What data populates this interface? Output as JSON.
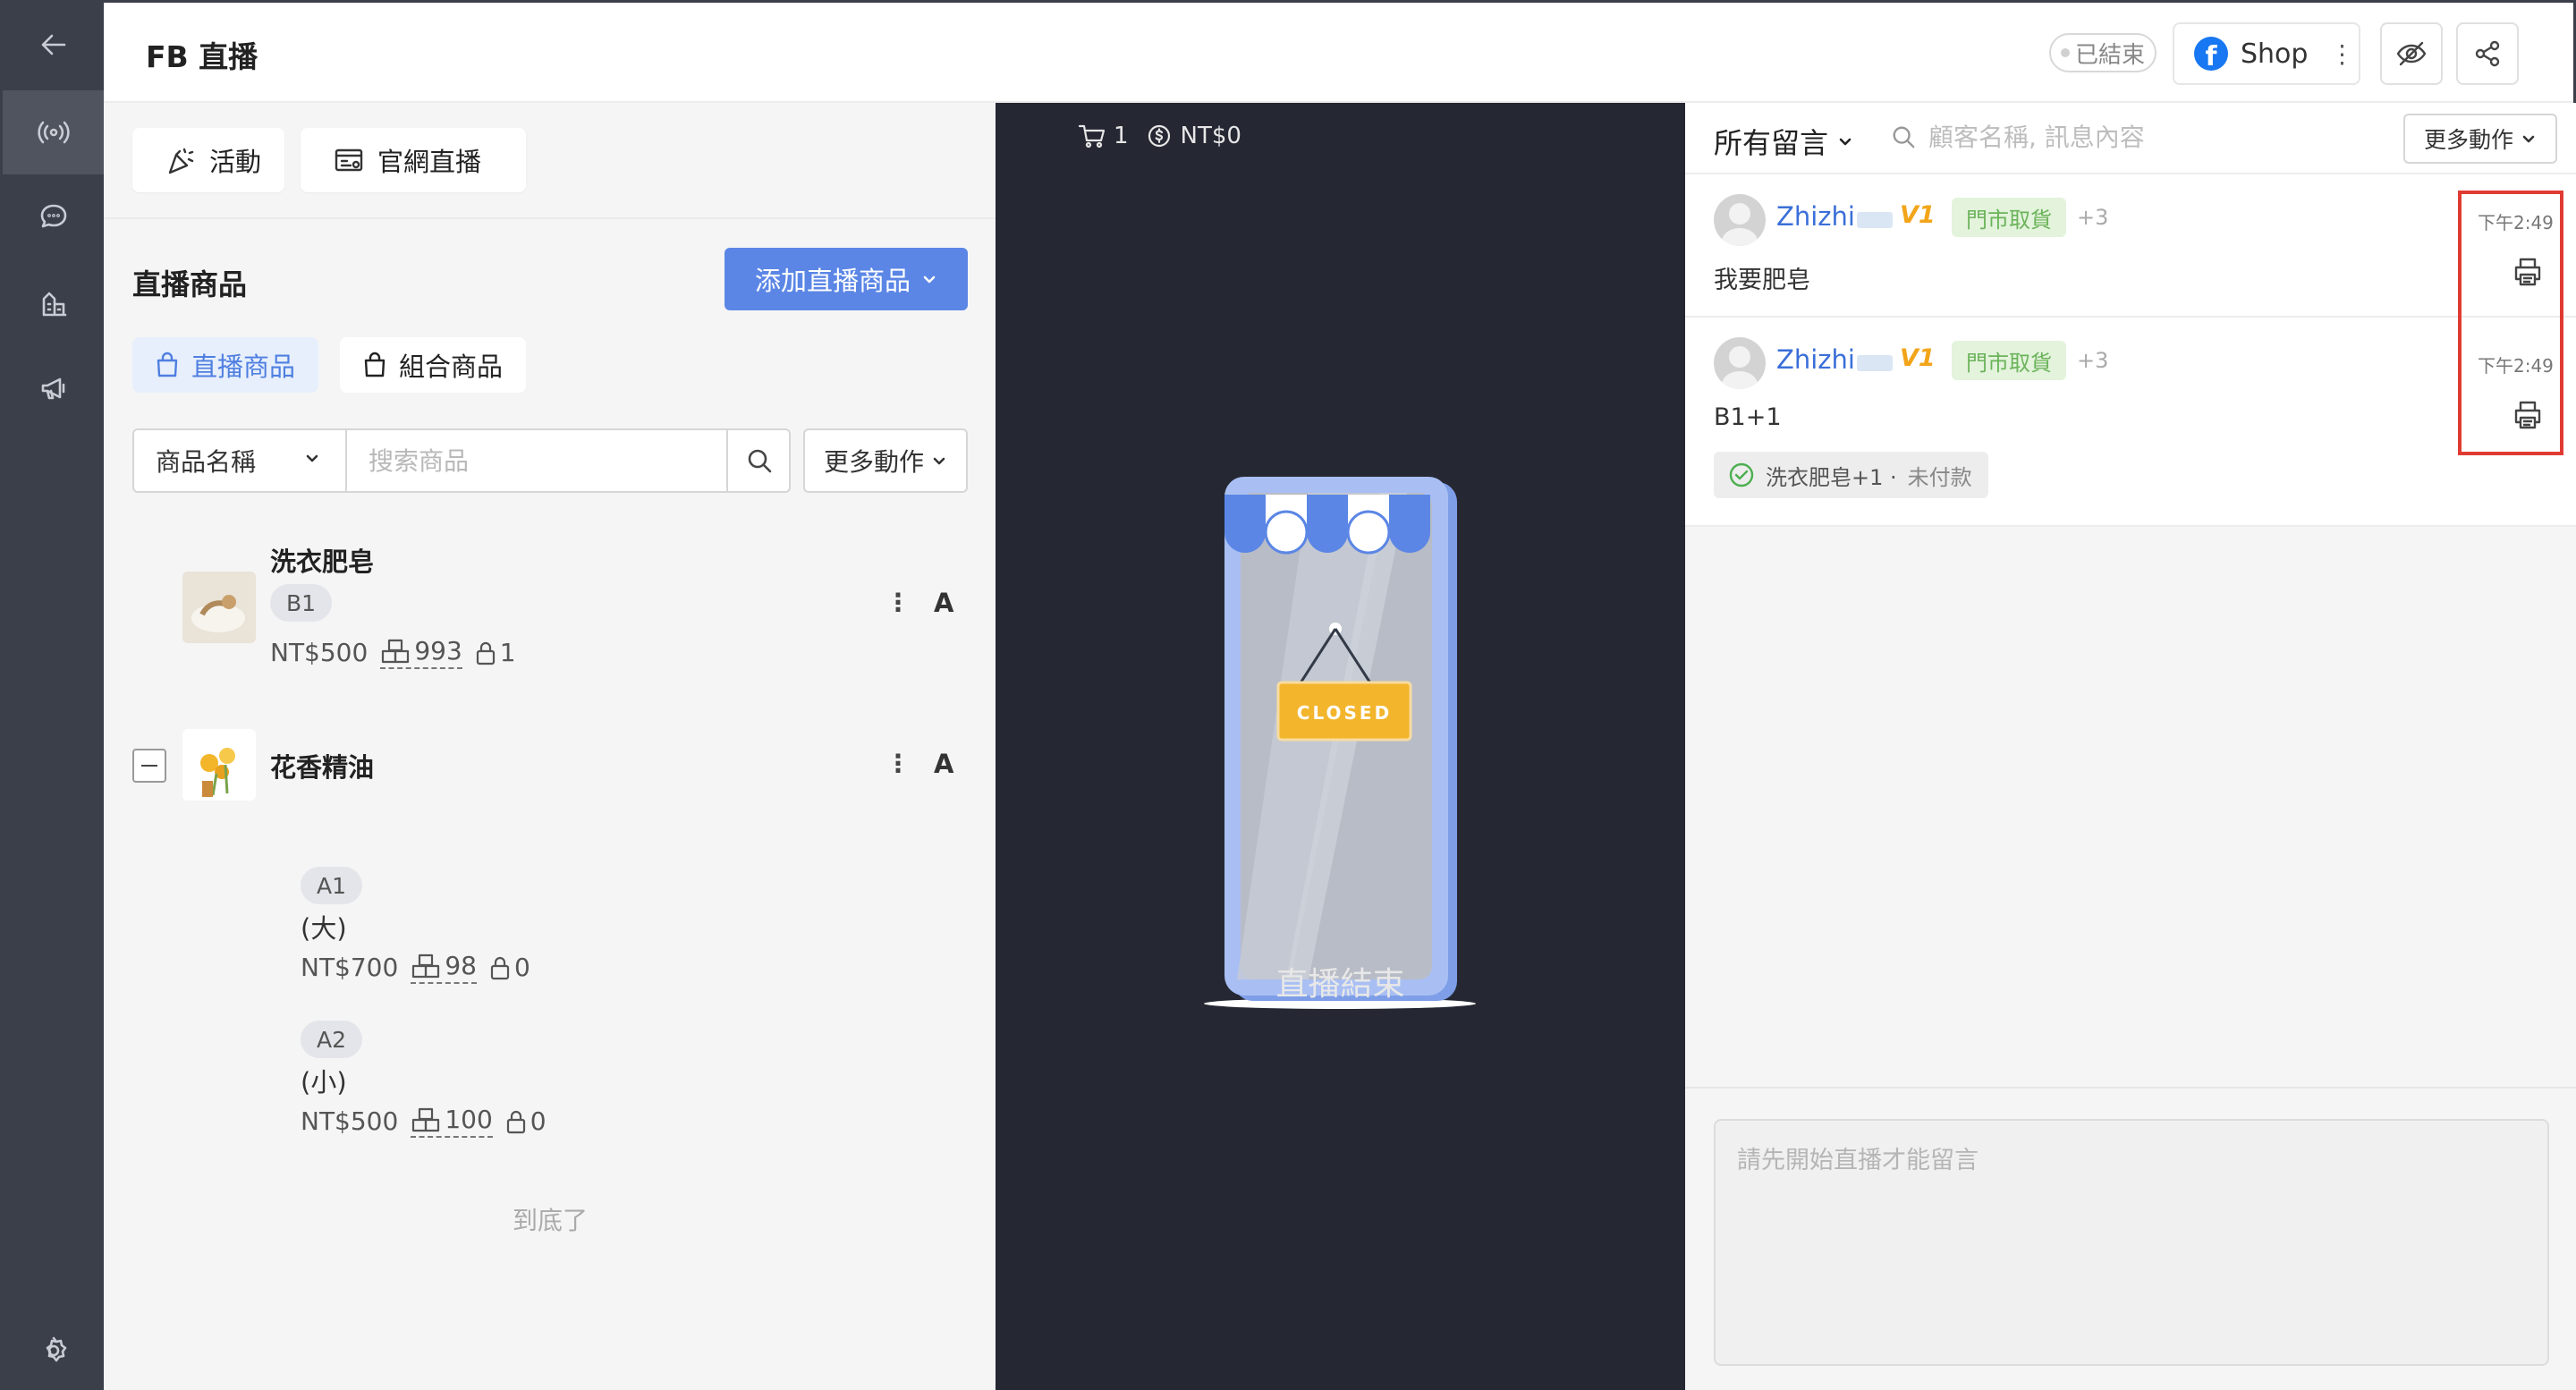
{
  "header": {
    "title": "FB 直播",
    "status": "已結束",
    "shop_name": "Shop"
  },
  "rail": {
    "items": [
      "back-icon",
      "live-broadcast-icon",
      "chat-icon",
      "store-icon",
      "megaphone-icon",
      "settings-icon"
    ]
  },
  "left": {
    "quick_actions": [
      "活動",
      "官網直播"
    ],
    "section_title": "直播商品",
    "add_button": "添加直播商品",
    "tabs": [
      "直播商品",
      "組合商品"
    ],
    "filter_select": "商品名稱",
    "search_placeholder": "搜索商品",
    "more_actions": "更多動作",
    "products": [
      {
        "name": "洗衣肥皂",
        "sku": "B1",
        "price": "NT$500",
        "stock": "993",
        "locked": "1",
        "mark": "A"
      },
      {
        "name": "花香精油",
        "mark": "A",
        "variants": [
          {
            "sku": "A1",
            "label": "(大)",
            "price": "NT$700",
            "stock": "98",
            "locked": "0"
          },
          {
            "sku": "A2",
            "label": "(小)",
            "price": "NT$500",
            "stock": "100",
            "locked": "0"
          }
        ]
      }
    ],
    "end_text": "到底了"
  },
  "center": {
    "cart_count": "1",
    "cart_total": "NT$0",
    "closed_sign": "CLOSED",
    "message": "直播結束"
  },
  "right": {
    "filter_all": "所有留言",
    "search_placeholder": "顧客名稱, 訊息內容",
    "more_actions": "更多動作",
    "comments": [
      {
        "name": "Zhizhi",
        "badge": "V1",
        "tag": "門市取貨",
        "extra": "+3",
        "time": "下午2:49",
        "text": "我要肥皂"
      },
      {
        "name": "Zhizhi",
        "badge": "V1",
        "tag": "門市取貨",
        "extra": "+3",
        "time": "下午2:49",
        "text": "B1+1",
        "order": "洗衣肥皂+1 ·",
        "order_status": "未付款"
      }
    ],
    "input_placeholder": "請先開始直播才能留言"
  },
  "colors": {
    "rail": "#3b3f4a",
    "primary": "#5b86e5",
    "center_bg": "#252833",
    "highlight": "#e03b32",
    "tag_green": "#6bb35a"
  }
}
